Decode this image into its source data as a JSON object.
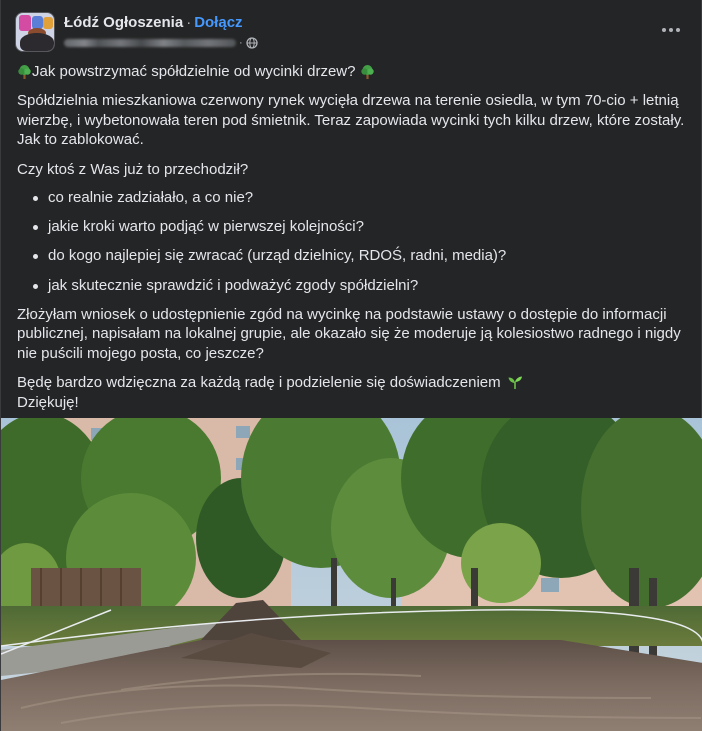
{
  "post": {
    "group_name": "Łódź Ogłoszenia",
    "separator": "·",
    "join_label": "Dołącz",
    "author_blurred": true,
    "privacy_icon": "globe-icon",
    "more_icon": "more-options-icon"
  },
  "content": {
    "title": "Jak powstrzymać spółdzielnie od wycinki drzew?",
    "title_icon": "tree-icon",
    "paragraph1": "Spółdzielnia mieszkaniowa czerwony rynek wycięła drzewa na terenie osiedla, w tym 70-cio + letnią wierzbę, i wybetonowała teren pod śmietnik. Teraz zapowiada wycinki tych kilku drzew, które zostały. Jak to zablokować.",
    "question": "Czy ktoś z Was już to przechodził?",
    "bullets": [
      "co realnie zadziałało, a co nie?",
      "jakie kroki warto podjąć w pierwszej kolejności?",
      "do kogo najlepiej się zwracać (urząd dzielnicy, RDOŚ, radni, media)?",
      "jak skutecznie sprawdzić i podważyć zgody spółdzielni?"
    ],
    "paragraph2": "Złożyłam wniosek o udostępnienie zgód na wycinkę na podstawie ustawy o dostępie do informacji publicznej, napisałam na lokalnej grupie, ale okazało się że moderuje ją kolesiostwo radnego i nigdy nie puścili mojego posta, co jeszcze?",
    "closing": "Będę bardzo wdzięczna za każdą radę i podzielenie się doświadczeniem",
    "closing_icon": "seedling-icon",
    "thanks": "Dziękuję!"
  },
  "photo": {
    "subject": "excavated dirt area with trees and apartment blocks"
  },
  "colors": {
    "background": "#242526",
    "text": "#e4e6eb",
    "secondary": "#b0b3b8",
    "link": "#4599ff"
  }
}
